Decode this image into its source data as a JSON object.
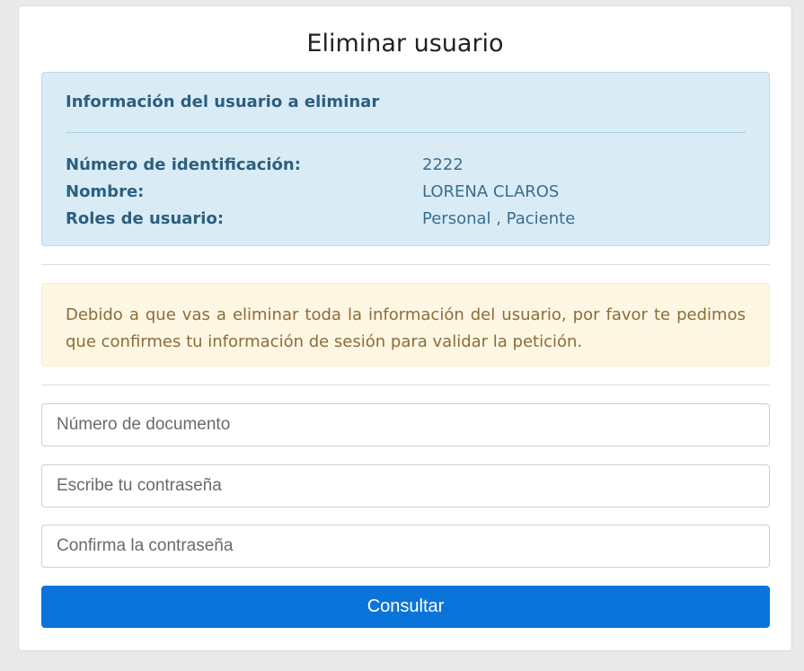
{
  "page": {
    "title": "Eliminar usuario"
  },
  "user_info": {
    "heading": "Información del usuario a eliminar",
    "rows": [
      {
        "label": "Número de identificación:",
        "value": "2222"
      },
      {
        "label": "Nombre:",
        "value": "LORENA CLAROS"
      },
      {
        "label": "Roles de usuario:",
        "value": "Personal , Paciente"
      }
    ]
  },
  "warning": {
    "text": "Debido a que vas a eliminar toda la información del usuario, por favor te pedimos que confirmes tu información de sesión para validar la petición."
  },
  "form": {
    "document_placeholder": "Número de documento",
    "password_placeholder": "Escribe tu contraseña",
    "confirm_placeholder": "Confirma la contraseña",
    "submit_label": "Consultar"
  },
  "colors": {
    "background": "#e9e9e9",
    "info_bg": "#d9ecf6",
    "info_text": "#2d5f7e",
    "warning_bg": "#fdf6e2",
    "warning_text": "#8a6d3b",
    "primary_button": "#0b74da"
  }
}
